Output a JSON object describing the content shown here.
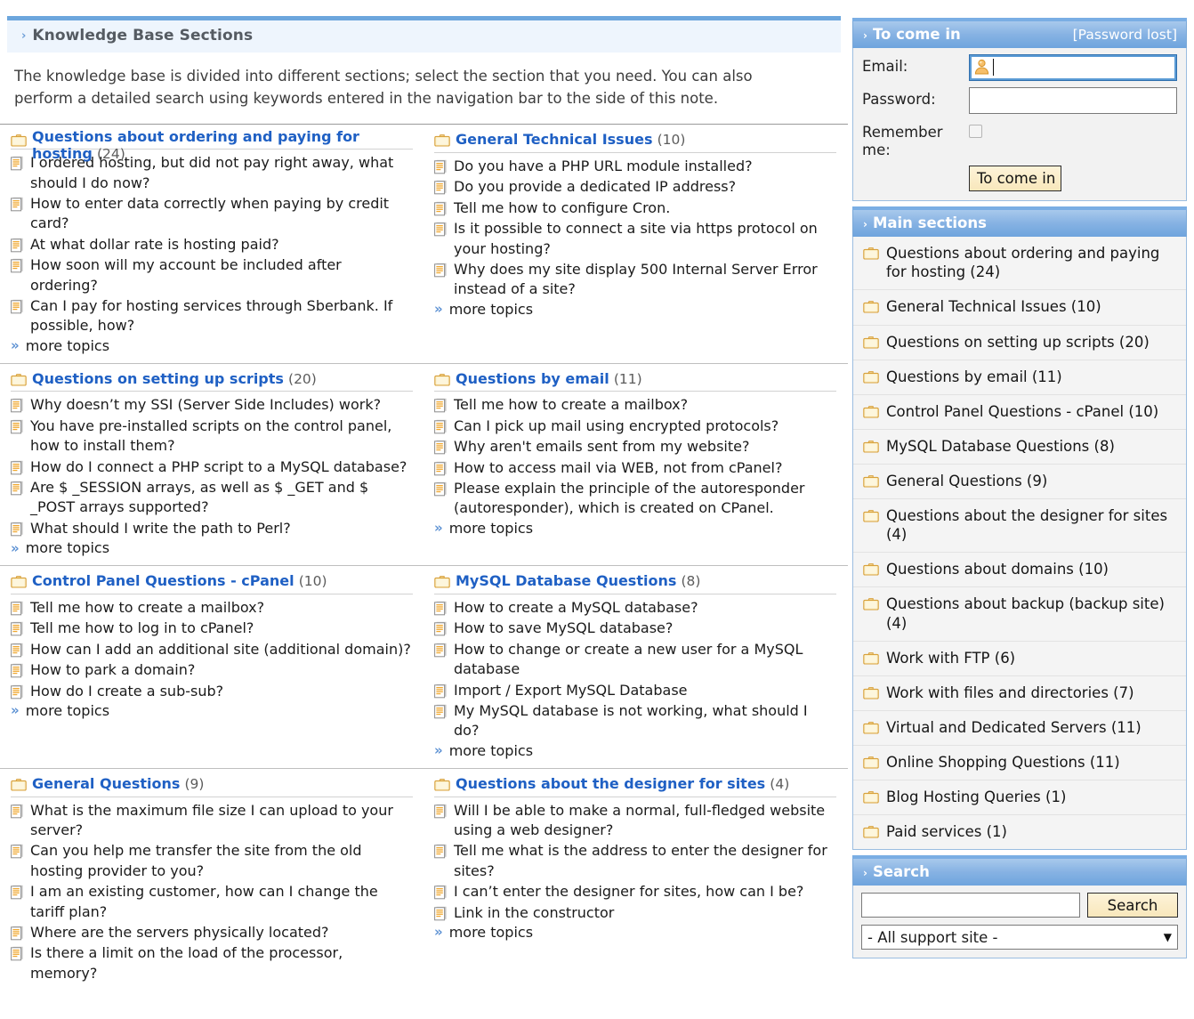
{
  "knowledge_base": {
    "header": {
      "marker": "›",
      "title": "Knowledge Base Sections"
    },
    "intro": "The knowledge base is divided into different sections; select the section that you need. You can also perform a detailed search using keywords entered in the navigation bar to the side of this note.",
    "more_label": "more topics",
    "more_chevron": "»",
    "sections": [
      {
        "title": "Questions about ordering and paying for hosting",
        "count": "(24)",
        "topics": [
          "I ordered hosting, but did not pay right away, what should I do now?",
          "How to enter data correctly when paying by credit card?",
          "At what dollar rate is hosting paid?",
          "How soon will my account be included after ordering?",
          "Can I pay for hosting services through Sberbank. If possible, how?"
        ],
        "has_more": true
      },
      {
        "title": "General Technical Issues",
        "count": "(10)",
        "topics": [
          "Do you have a PHP URL module installed?",
          "Do you provide a dedicated IP address?",
          "Tell me how to configure Cron.",
          "Is it possible to connect a site via https protocol on your hosting?",
          "Why does my site display 500 Internal Server Error instead of a site?"
        ],
        "has_more": true
      },
      {
        "title": "Questions on setting up scripts",
        "count": "(20)",
        "topics": [
          "Why doesn’t my SSI (Server Side Includes) work?",
          "You have pre-installed scripts on the control panel, how to install them?",
          "How do I connect a PHP script to a MySQL database?",
          "Are $ _SESSION arrays, as well as $ _GET and $ _POST arrays supported?",
          "What should I write the path to Perl?"
        ],
        "has_more": true
      },
      {
        "title": "Questions by email",
        "count": "(11)",
        "topics": [
          "Tell me how to create a mailbox?",
          "Can I pick up mail using encrypted protocols?",
          "Why aren't emails sent from my website?",
          "How to access mail via WEB, not from cPanel?",
          "Please explain the principle of the autoresponder (autoresponder), which is created on CPanel."
        ],
        "has_more": true
      },
      {
        "title": "Control Panel Questions - cPanel",
        "count": "(10)",
        "topics": [
          "Tell me how to create a mailbox?",
          "Tell me how to log in to cPanel?",
          "How can I add an additional site (additional domain)?",
          "How to park a domain?",
          "How do I create a sub-sub?"
        ],
        "has_more": true
      },
      {
        "title": "MySQL Database Questions",
        "count": "(8)",
        "topics": [
          "How to create a MySQL database?",
          "How to save MySQL database?",
          "How to change or create a new user for a MySQL database",
          "Import / Export MySQL Database",
          "My MySQL database is not working, what should I do?"
        ],
        "has_more": true
      },
      {
        "title": "General Questions",
        "count": "(9)",
        "topics": [
          "What is the maximum file size I can upload to your server?",
          "Can you help me transfer the site from the old hosting provider to you?",
          "I am an existing customer, how can I change the tariff plan?",
          "Where are the servers physically located?",
          "Is there a limit on the load of the processor, memory?"
        ],
        "has_more": false
      },
      {
        "title": "Questions about the designer for sites",
        "count": "(4)",
        "topics": [
          "Will I be able to make a normal, full-fledged website using a web designer?",
          "Tell me what is the address to enter the designer for sites?",
          "I can’t enter the designer for sites, how can I be?",
          "Link in the constructor"
        ],
        "has_more": true
      }
    ]
  },
  "login": {
    "marker": "›",
    "title": "To come in",
    "password_lost_label": "[Password lost]",
    "email_label": "Email:",
    "email_value": "",
    "email_placeholder": "",
    "password_label": "Password:",
    "password_value": "",
    "remember_label": "Remember me:",
    "remember_checked": false,
    "submit_label": "To come in",
    "user_icon": "person-icon"
  },
  "main_sections": {
    "marker": "›",
    "title": "Main sections",
    "items": [
      {
        "label": "Questions about ordering and paying for hosting (24)"
      },
      {
        "label": "General Technical Issues (10)"
      },
      {
        "label": "Questions on setting up scripts (20)"
      },
      {
        "label": "Questions by email (11)"
      },
      {
        "label": "Control Panel Questions - cPanel (10)"
      },
      {
        "label": "MySQL Database Questions (8)"
      },
      {
        "label": "General Questions (9)"
      },
      {
        "label": "Questions about the designer for sites (4)"
      },
      {
        "label": "Questions about domains (10)"
      },
      {
        "label": "Questions about backup (backup site) (4)"
      },
      {
        "label": "Work with FTP (6)"
      },
      {
        "label": "Work with files and directories (7)"
      },
      {
        "label": "Virtual and Dedicated Servers (11)"
      },
      {
        "label": "Online Shopping Questions (11)"
      },
      {
        "label": "Blog Hosting Queries (1)"
      },
      {
        "label": "Paid services (1)"
      }
    ]
  },
  "search": {
    "marker": "›",
    "title": "Search",
    "query_value": "",
    "query_placeholder": "",
    "button_label": "Search",
    "scope_selected": "- All support site -",
    "scope_arrow": "▼",
    "scope_options": [
      "- All support site -"
    ]
  },
  "colors": {
    "accent_blue": "#6ca6dd",
    "header_bg": "#eef5fd",
    "link_blue": "#1f60c4",
    "panel_gradient_top": "#a8c9ec",
    "panel_gradient_bottom": "#6ea4dd",
    "button_cream": "#f8e7bb",
    "folder_icon": "#f3c76a",
    "doc_icon": "#f0a830"
  }
}
